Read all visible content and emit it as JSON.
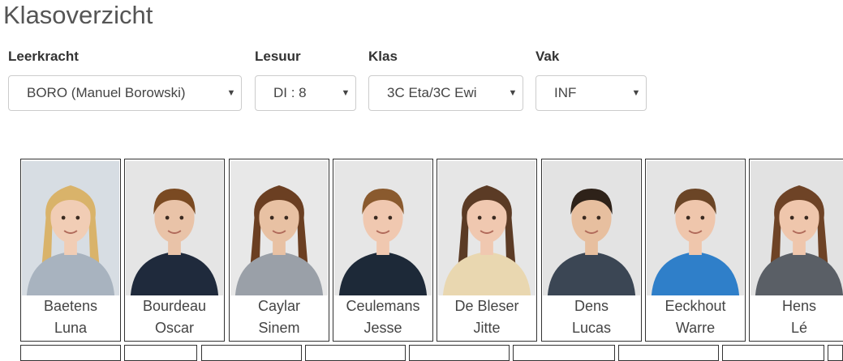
{
  "page": {
    "title": "Klasoverzicht"
  },
  "filters": {
    "teacher": {
      "label": "Leerkracht",
      "value": "BORO (Manuel Borowski)"
    },
    "period": {
      "label": "Lesuur",
      "value": "DI : 8"
    },
    "class": {
      "label": "Klas",
      "value": "3C Eta/3C Ewi"
    },
    "subject": {
      "label": "Vak",
      "value": "INF"
    }
  },
  "students": [
    {
      "last_name": "Baetens",
      "first_name": "Luna",
      "bg": "#d7dde3",
      "hair": "#d9b36a",
      "shirt": "#a8b3bf",
      "skin": "#f1cdb5",
      "long_hair": true
    },
    {
      "last_name": "Bourdeau",
      "first_name": "Oscar",
      "bg": "#e5e5e5",
      "hair": "#7a4a22",
      "shirt": "#1f2a3c",
      "skin": "#e9c3a8",
      "long_hair": false
    },
    {
      "last_name": "Caylar",
      "first_name": "Sinem",
      "bg": "#e8e8e8",
      "hair": "#6b3f22",
      "shirt": "#9aa0a8",
      "skin": "#e8c1a3",
      "long_hair": true
    },
    {
      "last_name": "Ceulemans",
      "first_name": "Jesse",
      "bg": "#e6e6e6",
      "hair": "#8a5a2e",
      "shirt": "#1d2938",
      "skin": "#f0c8b0",
      "long_hair": false
    },
    {
      "last_name": "De Bleser",
      "first_name": "Jitte",
      "bg": "#e6e6e6",
      "hair": "#5b3b25",
      "shirt": "#e9d7b0",
      "skin": "#f0c8b0",
      "long_hair": true
    },
    {
      "last_name": "Dens",
      "first_name": "Lucas",
      "bg": "#e3e3e3",
      "hair": "#2e2219",
      "shirt": "#3b4654",
      "skin": "#e7bf9f",
      "long_hair": false
    },
    {
      "last_name": "Eeckhout",
      "first_name": "Warre",
      "bg": "#e4e4e4",
      "hair": "#6b4526",
      "shirt": "#2f7fc9",
      "skin": "#efc6ac",
      "long_hair": false
    },
    {
      "last_name": "Hens",
      "first_name": "Lé",
      "bg": "#e2e2e2",
      "hair": "#6e4326",
      "shirt": "#5a5f66",
      "skin": "#efc6ac",
      "long_hair": true
    }
  ]
}
